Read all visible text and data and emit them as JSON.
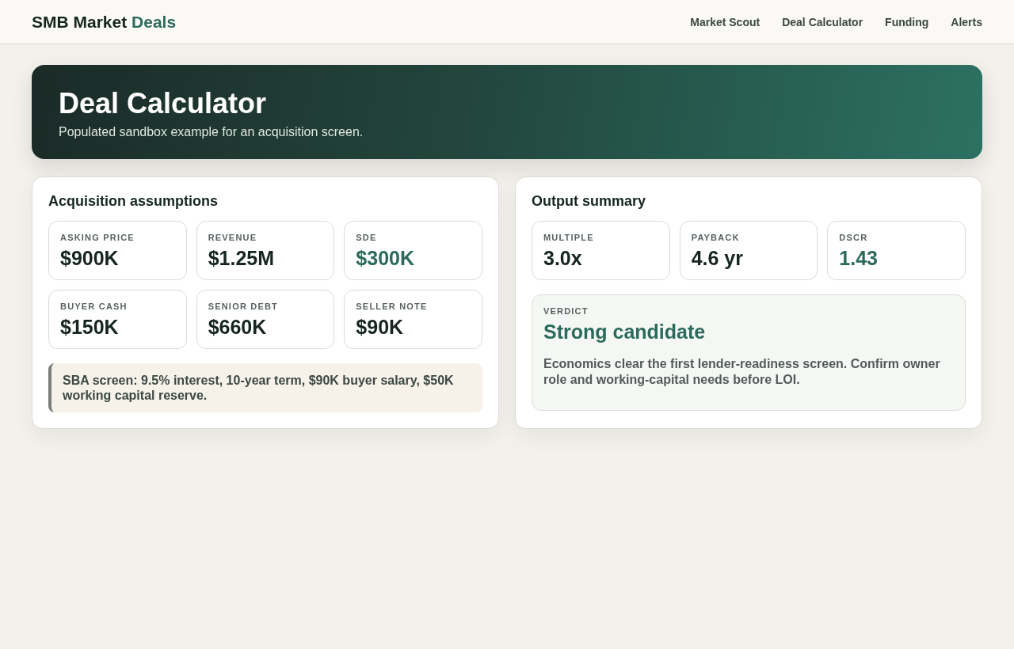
{
  "brand": {
    "text": "SMB Market",
    "accent": "Deals"
  },
  "nav": [
    "Market Scout",
    "Deal Calculator",
    "Funding",
    "Alerts"
  ],
  "hero": {
    "title": "Deal Calculator",
    "subtitle": "Populated sandbox example for an acquisition screen."
  },
  "assumptions": {
    "title": "Acquisition assumptions",
    "metrics": [
      {
        "label": "ASKING PRICE",
        "value": "$900K",
        "highlight": false
      },
      {
        "label": "REVENUE",
        "value": "$1.25M",
        "highlight": false
      },
      {
        "label": "SDE",
        "value": "$300K",
        "highlight": true
      },
      {
        "label": "BUYER CASH",
        "value": "$150K",
        "highlight": false
      },
      {
        "label": "SENIOR DEBT",
        "value": "$660K",
        "highlight": false
      },
      {
        "label": "SELLER NOTE",
        "value": "$90K",
        "highlight": false
      }
    ],
    "note": "SBA screen: 9.5% interest, 10-year term, $90K buyer salary, $50K working capital reserve."
  },
  "output": {
    "title": "Output summary",
    "metrics": [
      {
        "label": "MULTIPLE",
        "value": "3.0x",
        "highlight": false
      },
      {
        "label": "PAYBACK",
        "value": "4.6 yr",
        "highlight": false
      },
      {
        "label": "DSCR",
        "value": "1.43",
        "highlight": true
      }
    ],
    "verdict": {
      "label": "VERDICT",
      "title": "Strong candidate",
      "text": "Economics clear the first lender-readiness screen. Confirm owner role and working-capital needs before LOI."
    }
  }
}
